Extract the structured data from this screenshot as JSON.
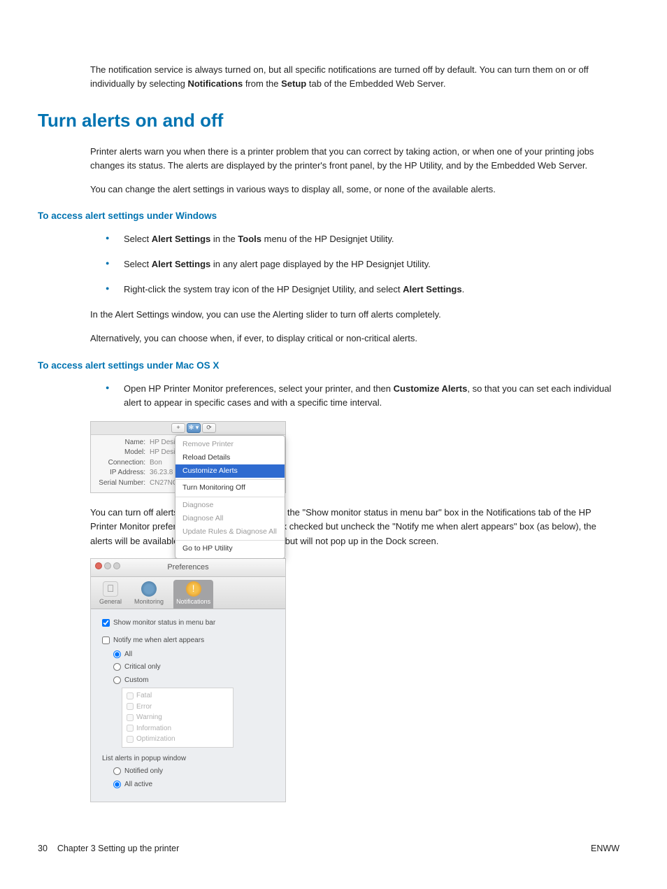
{
  "intro": {
    "notification_para": "The notification service is always turned on, but all specific notifications are turned off by default. You can turn them on or off individually by selecting ",
    "notification_bold1": "Notifications",
    "notification_mid": " from the ",
    "notification_bold2": "Setup",
    "notification_end": " tab of the Embedded Web Server."
  },
  "title": "Turn alerts on and off",
  "p1": "Printer alerts warn you when there is a printer problem that you can correct by taking action, or when one of your printing jobs changes its status. The alerts are displayed by the printer's front panel, by the HP Utility, and by the Embedded Web Server.",
  "p2": "You can change the alert settings in various ways to display all, some, or none of the available alerts.",
  "win": {
    "heading": "To access alert settings under Windows",
    "b1_pre": "Select ",
    "b1_bold1": "Alert Settings",
    "b1_mid": " in the ",
    "b1_bold2": "Tools",
    "b1_end": " menu of the HP Designjet Utility.",
    "b2_pre": "Select ",
    "b2_bold": "Alert Settings",
    "b2_end": " in any alert page displayed by the HP Designjet Utility.",
    "b3_pre": "Right-click the system tray icon of the HP Designjet Utility, and select ",
    "b3_bold": "Alert Settings",
    "b3_end": ".",
    "after1": "In the Alert Settings window, you can use the Alerting slider to turn off alerts completely.",
    "after2": "Alternatively, you can choose when, if ever, to display critical or non-critical alerts."
  },
  "mac": {
    "heading": "To access alert settings under Mac OS X",
    "b1_pre": "Open HP Printer Monitor preferences, select your printer, and then ",
    "b1_bold": "Customize Alerts",
    "b1_end": ", so that you can set each individual alert to appear in specific cases and with a specific time interval.",
    "after": "You can turn off alerts completely by unchecking the \"Show monitor status in menu bar\" box in the Notifications tab of the HP Printer Monitor preferences. If you leave that box checked but uncheck the \"Notify me when alert appears\" box (as below), the alerts will be available in the HP Printer Monitor, but will not pop up in the Dock screen."
  },
  "shot1": {
    "labels": {
      "name": "Name:",
      "model": "Model:",
      "conn": "Connection:",
      "ip": "IP Address:",
      "serial": "Serial Number:"
    },
    "vals": {
      "name": "HP Desi",
      "model": "HP Desi",
      "conn": "Bon",
      "ip": "36.23.8",
      "serial": "CN27NC"
    },
    "menu": {
      "remove": "Remove Printer",
      "reload": "Reload Details",
      "customize": "Customize Alerts",
      "turnoff": "Turn Monitoring Off",
      "diag": "Diagnose",
      "diagall": "Diagnose All",
      "update": "Update Rules & Diagnose All",
      "gohp": "Go to HP Utility"
    }
  },
  "shot2": {
    "title": "Preferences",
    "tabs": {
      "general": "General",
      "monitoring": "Monitoring",
      "notifications": "Notifications"
    },
    "chk_show": "Show monitor status in menu bar",
    "chk_notify": "Notify me when alert appears",
    "r_all": "All",
    "r_critical": "Critical only",
    "r_custom": "Custom",
    "sub": {
      "fatal": "Fatal",
      "error": "Error",
      "warning": "Warning",
      "info": "Information",
      "opt": "Optimization"
    },
    "list_heading": "List alerts in popup window",
    "r_notified": "Notified only",
    "r_active": "All active"
  },
  "footer": {
    "left_num": "30",
    "left_text": "Chapter 3   Setting up the printer",
    "right": "ENWW"
  }
}
